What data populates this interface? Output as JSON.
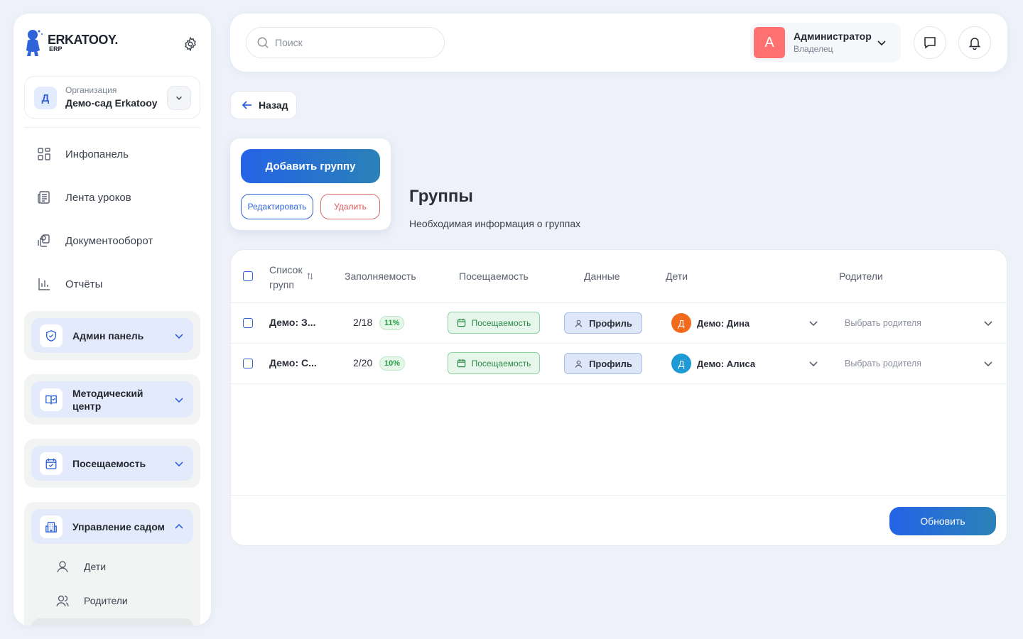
{
  "app": {
    "logo_name": "ERKATOOY.",
    "logo_sub": "ERP"
  },
  "sidebar": {
    "org": {
      "avatar_letter": "Д",
      "label": "Организация",
      "name": "Демо-сад Erkatooy"
    },
    "nav": [
      {
        "label": "Инфопанель",
        "icon": "dashboard-icon"
      },
      {
        "label": "Лента уроков",
        "icon": "newspaper-icon"
      },
      {
        "label": "Документооборот",
        "icon": "documents-icon"
      },
      {
        "label": "Отчёты",
        "icon": "bar-chart-icon"
      }
    ],
    "sections": [
      {
        "title": "Админ панель",
        "icon": "shield-icon",
        "expanded": false
      },
      {
        "title": "Методический центр",
        "icon": "book-icon",
        "expanded": false
      },
      {
        "title": "Посещаемость",
        "icon": "calendar-check-icon",
        "expanded": false
      },
      {
        "title": "Управление садом",
        "icon": "building-icon",
        "expanded": true,
        "items": [
          {
            "label": "Дети",
            "icon": "user-icon"
          },
          {
            "label": "Родители",
            "icon": "users-icon"
          }
        ]
      }
    ]
  },
  "header": {
    "search_placeholder": "Поиск",
    "user": {
      "avatar_letter": "А",
      "name": "Администратор",
      "role": "Владелец",
      "avatar_color": "#ff7070"
    }
  },
  "main": {
    "back_label": "Назад",
    "add_group_label": "Добавить группу",
    "edit_label": "Редактировать",
    "delete_label": "Удалить",
    "title": "Группы",
    "subtitle": "Необходимая информация о группах",
    "refresh_label": "Обновить"
  },
  "table": {
    "columns": {
      "list_line1": "Список",
      "list_line2": "групп",
      "fill": "Заполняемость",
      "attendance": "Посещаемость",
      "data": "Данные",
      "children": "Дети",
      "parents": "Родители"
    },
    "rows": [
      {
        "name": "Демо: З...",
        "fill": "2/18",
        "fill_pct": "11%",
        "attendance_label": "Посещаемость",
        "profile_label": "Профиль",
        "child_letter": "Д",
        "child_name": "Демо: Дина",
        "child_color": "#f26b1d",
        "parent_placeholder": "Выбрать родителя"
      },
      {
        "name": "Демо: С...",
        "fill": "2/20",
        "fill_pct": "10%",
        "attendance_label": "Посещаемость",
        "profile_label": "Профиль",
        "child_letter": "Д",
        "child_name": "Демо: Алиса",
        "child_color": "#1e9ad6",
        "parent_placeholder": "Выбрать родителя"
      }
    ]
  },
  "colors": {
    "accent": "#2563e6",
    "background": "#eef1f9",
    "danger": "#e05656",
    "success": "#27a046"
  }
}
